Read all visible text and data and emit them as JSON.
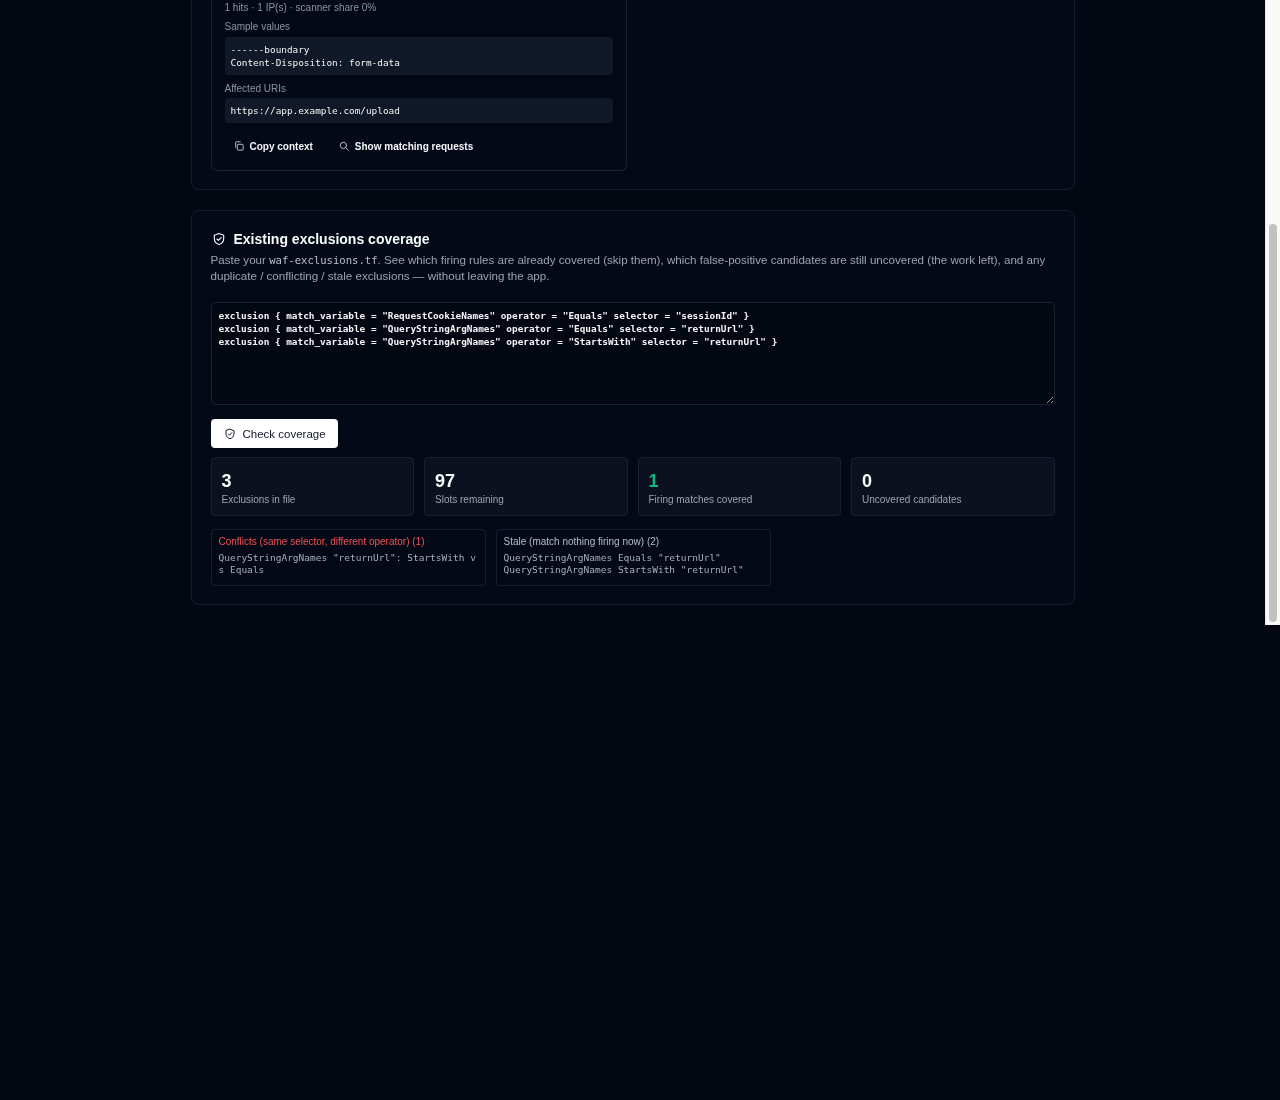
{
  "rule_card": {
    "summary": "1 hits · 1 IP(s) · scanner share 0%",
    "sections": [
      {
        "label": "Sample values",
        "lines": [
          "------boundary",
          "Content-Disposition: form-data"
        ]
      },
      {
        "label": "Affected URIs",
        "lines": [
          "https://app.example.com/upload"
        ]
      }
    ],
    "actions": [
      "Copy context",
      "Show matching requests"
    ]
  },
  "coverage": {
    "title": "Existing exclusions coverage",
    "description": {
      "lead": "Paste your",
      "file": "waf-exclusions.tf",
      "rest": ". See which firing rules are already covered (skip them), which false-positive candidates are still uncovered (the work left), and any duplicate / conflicting / stale exclusions — without leaving the app."
    },
    "exclusions_input": {
      "value": "exclusion { match_variable = \"RequestCookieNames\" operator = \"Equals\" selector = \"sessionId\" }\nexclusion { match_variable = \"QueryStringArgNames\" operator = \"Equals\" selector = \"returnUrl\" }\nexclusion { match_variable = \"QueryStringArgNames\" operator = \"StartsWith\" selector = \"returnUrl\" }"
    },
    "check_button": "Check coverage",
    "stats": [
      {
        "value": "3",
        "label": "Exclusions in file",
        "color": "#f9fafb"
      },
      {
        "value": "97",
        "label": "Slots remaining",
        "color": "#f9fafb"
      },
      {
        "value": "1",
        "label": "Firing matches covered",
        "color": "#10b981"
      },
      {
        "value": "0",
        "label": "Uncovered candidates",
        "color": "#f9fafb"
      }
    ],
    "findings": [
      {
        "kind": "conflict",
        "title": "Conflicts (same selector, different operator) (1)",
        "items": [
          "QueryStringArgNames \"returnUrl\": StartsWith vs Equals"
        ]
      },
      {
        "kind": "stale",
        "title": "Stale (match nothing firing now) (2)",
        "items": [
          "QueryStringArgNames Equals \"returnUrl\"",
          "QueryStringArgNames StartsWith \"returnUrl\""
        ]
      }
    ]
  }
}
